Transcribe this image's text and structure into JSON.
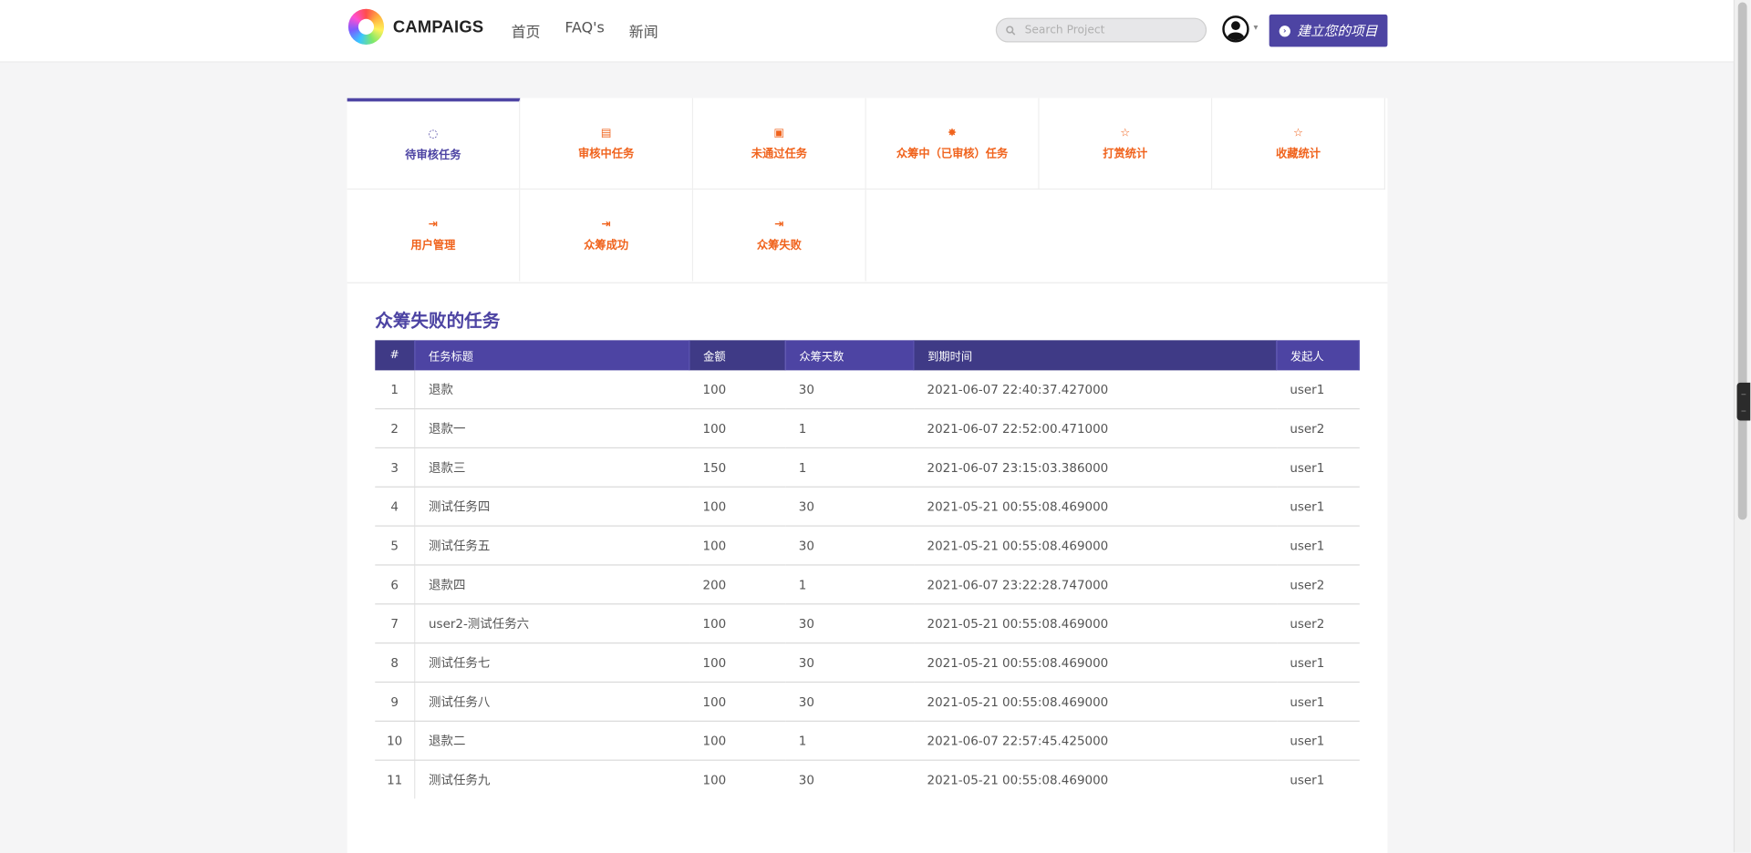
{
  "brand": {
    "name": "CAMPAIGS"
  },
  "nav": {
    "items": [
      "首页",
      "FAQ's",
      "新闻"
    ]
  },
  "search": {
    "placeholder": "Search Project",
    "value": ""
  },
  "header": {
    "create_button_label": "建立您的项目",
    "create_button_icon": "chevron-right-circle-icon",
    "avatar_icon": "user-circle-icon",
    "caret": "▾"
  },
  "tabs": [
    {
      "label": "待审核任务",
      "icon": "◌",
      "icon_name": "spinner-icon",
      "active": true
    },
    {
      "label": "审核中任务",
      "icon": "▤",
      "icon_name": "save-icon",
      "active": false
    },
    {
      "label": "未通过任务",
      "icon": "▣",
      "icon_name": "image-icon",
      "active": false
    },
    {
      "label": "众筹中（已审核）任务",
      "icon": "✸",
      "icon_name": "gear-icon",
      "active": false
    },
    {
      "label": "打赏统计",
      "icon": "☆",
      "icon_name": "star-icon",
      "active": false
    },
    {
      "label": "收藏统计",
      "icon": "☆",
      "icon_name": "star-icon",
      "active": false
    },
    {
      "label": "用户管理",
      "icon": "⇥",
      "icon_name": "sign-in-icon",
      "active": false
    },
    {
      "label": "众筹成功",
      "icon": "⇥",
      "icon_name": "sign-in-icon",
      "active": false
    },
    {
      "label": "众筹失败",
      "icon": "⇥",
      "icon_name": "sign-in-icon",
      "active": false
    }
  ],
  "section": {
    "title": "众筹失败的任务"
  },
  "table": {
    "headers": [
      "#",
      "任务标题",
      "金额",
      "众筹天数",
      "到期时间",
      "发起人"
    ],
    "rows": [
      [
        "1",
        "退款",
        "100",
        "30",
        "2021-06-07 22:40:37.427000",
        "user1"
      ],
      [
        "2",
        "退款一",
        "100",
        "1",
        "2021-06-07 22:52:00.471000",
        "user2"
      ],
      [
        "3",
        "退款三",
        "150",
        "1",
        "2021-06-07 23:15:03.386000",
        "user1"
      ],
      [
        "4",
        "测试任务四",
        "100",
        "30",
        "2021-05-21 00:55:08.469000",
        "user1"
      ],
      [
        "5",
        "测试任务五",
        "100",
        "30",
        "2021-05-21 00:55:08.469000",
        "user1"
      ],
      [
        "6",
        "退款四",
        "200",
        "1",
        "2021-06-07 23:22:28.747000",
        "user2"
      ],
      [
        "7",
        "user2-测试任务六",
        "100",
        "30",
        "2021-05-21 00:55:08.469000",
        "user2"
      ],
      [
        "8",
        "测试任务七",
        "100",
        "30",
        "2021-05-21 00:55:08.469000",
        "user1"
      ],
      [
        "9",
        "测试任务八",
        "100",
        "30",
        "2021-05-21 00:55:08.469000",
        "user1"
      ],
      [
        "10",
        "退款二",
        "100",
        "1",
        "2021-06-07 22:57:45.425000",
        "user1"
      ],
      [
        "11",
        "测试任务九",
        "100",
        "30",
        "2021-05-21 00:55:08.469000",
        "user1"
      ]
    ]
  },
  "colors": {
    "accent": "#4d44a3",
    "accent_dark": "#3f3a86",
    "tab_text": "#f0631d",
    "background": "#f5f5f6"
  }
}
